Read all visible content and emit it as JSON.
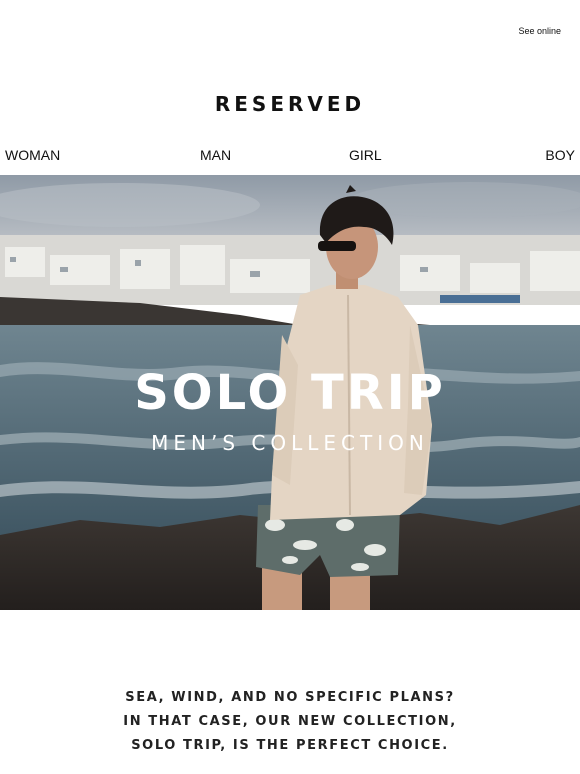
{
  "header": {
    "see_online": "See online",
    "logo": "RESERVED"
  },
  "nav": {
    "items": [
      {
        "label": "WOMAN"
      },
      {
        "label": "MAN"
      },
      {
        "label": "GIRL"
      },
      {
        "label": "BOY"
      }
    ]
  },
  "hero": {
    "title": "SOLO TRIP",
    "subtitle": "MEN’S COLLECTION"
  },
  "body": {
    "lines": [
      "SEA, WIND, AND NO SPECIFIC PLANS?",
      "IN THAT CASE, OUR NEW COLLECTION,",
      "SOLO TRIP, IS THE PERFECT CHOICE."
    ]
  },
  "colors": {
    "text": "#111111",
    "hero_text": "#ffffff"
  }
}
